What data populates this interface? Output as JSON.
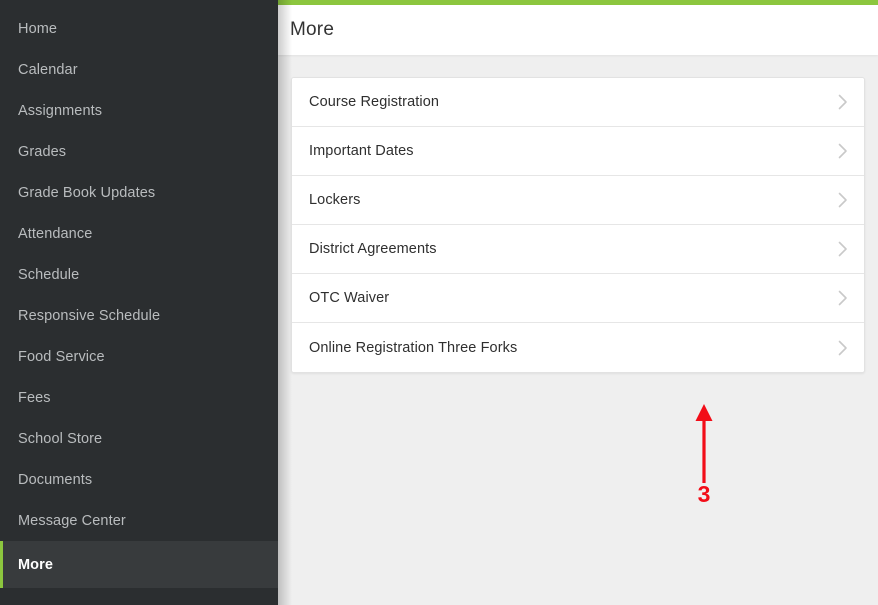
{
  "theme": {
    "accent_green": "#8cc63e",
    "sidebar_bg": "#2b2e30",
    "sidebar_active_bg": "#383b3d",
    "page_bg": "#efefef",
    "annotation_red": "#f20d18"
  },
  "sidebar": {
    "items": [
      {
        "label": "Home",
        "active": false
      },
      {
        "label": "Calendar",
        "active": false
      },
      {
        "label": "Assignments",
        "active": false
      },
      {
        "label": "Grades",
        "active": false
      },
      {
        "label": "Grade Book Updates",
        "active": false
      },
      {
        "label": "Attendance",
        "active": false
      },
      {
        "label": "Schedule",
        "active": false
      },
      {
        "label": "Responsive Schedule",
        "active": false
      },
      {
        "label": "Food Service",
        "active": false
      },
      {
        "label": "Fees",
        "active": false
      },
      {
        "label": "School Store",
        "active": false
      },
      {
        "label": "Documents",
        "active": false
      },
      {
        "label": "Message Center",
        "active": false
      },
      {
        "label": "More",
        "active": true
      }
    ]
  },
  "header": {
    "title": "More"
  },
  "main": {
    "list": [
      {
        "label": "Course Registration",
        "chevron": "chevron-right-icon"
      },
      {
        "label": "Important Dates",
        "chevron": "chevron-right-icon"
      },
      {
        "label": "Lockers",
        "chevron": "chevron-right-icon"
      },
      {
        "label": "District Agreements",
        "chevron": "chevron-right-icon"
      },
      {
        "label": "OTC Waiver",
        "chevron": "chevron-right-icon"
      },
      {
        "label": "Online Registration Three Forks",
        "chevron": "chevron-right-icon"
      }
    ]
  },
  "annotation": {
    "step_number": "3",
    "arrow": "up-arrow-icon",
    "points_to": "Online Registration Three Forks"
  }
}
